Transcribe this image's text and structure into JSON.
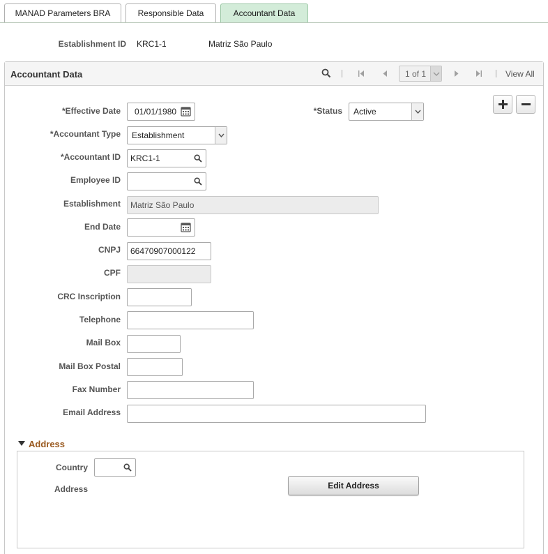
{
  "tabs": [
    {
      "label": "MANAD Parameters BRA",
      "active": false
    },
    {
      "label": "Responsible Data",
      "active": false
    },
    {
      "label": "Accountant Data",
      "active": true
    }
  ],
  "header": {
    "establishment_id_label": "Establishment ID",
    "establishment_id": "KRC1-1",
    "establishment_name": "Matriz São Paulo"
  },
  "grid": {
    "title": "Accountant Data",
    "pager_text": "1 of 1",
    "view_all": "View All",
    "icons": [
      "search-icon",
      "first-icon",
      "prev-icon",
      "next-icon",
      "last-icon"
    ]
  },
  "form": {
    "effective_date": {
      "label": "*Effective Date",
      "value": "01/01/1980"
    },
    "status": {
      "label": "*Status",
      "value": "Active"
    },
    "accountant_type": {
      "label": "*Accountant Type",
      "value": "Establishment"
    },
    "accountant_id": {
      "label": "*Accountant ID",
      "value": "KRC1-1"
    },
    "employee_id": {
      "label": "Employee ID",
      "value": ""
    },
    "establishment": {
      "label": "Establishment",
      "value": "Matriz São Paulo"
    },
    "end_date": {
      "label": "End Date",
      "value": ""
    },
    "cnpj": {
      "label": "CNPJ",
      "value": "66470907000122"
    },
    "cpf": {
      "label": "CPF",
      "value": ""
    },
    "crc_inscription": {
      "label": "CRC Inscription",
      "value": ""
    },
    "telephone": {
      "label": "Telephone",
      "value": ""
    },
    "mail_box": {
      "label": "Mail Box",
      "value": ""
    },
    "mail_box_postal": {
      "label": "Mail Box Postal",
      "value": ""
    },
    "fax_number": {
      "label": "Fax Number",
      "value": ""
    },
    "email_address": {
      "label": "Email Address",
      "value": ""
    }
  },
  "address": {
    "section_title": "Address",
    "country_label": "Country",
    "country_value": "",
    "address_label": "Address",
    "edit_button": "Edit Address"
  },
  "colors": {
    "active_tab": "#d3ecd9",
    "section_title": "#9a5a20"
  }
}
